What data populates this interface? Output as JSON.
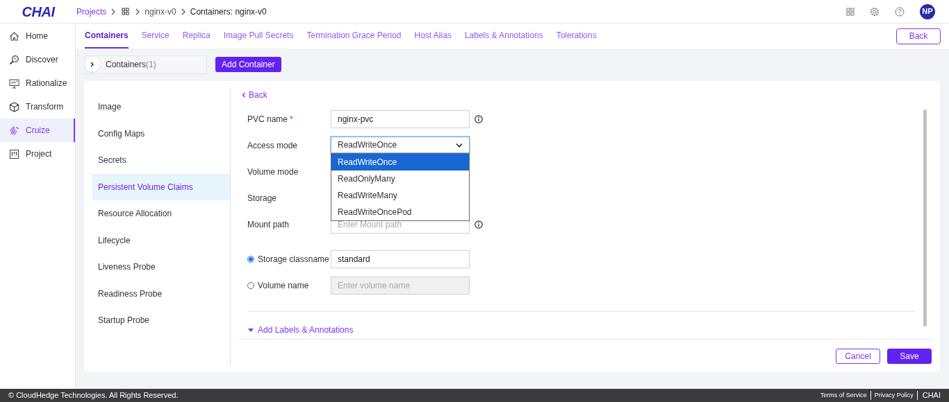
{
  "header": {
    "logo": "CHAI",
    "breadcrumb": [
      {
        "kind": "link",
        "text": "Projects"
      },
      {
        "kind": "icon"
      },
      {
        "kind": "text",
        "text": "nginx-v0"
      },
      {
        "kind": "current",
        "text": "Containers: nginx-v0"
      }
    ],
    "avatar": "NP"
  },
  "sidebar": {
    "items": [
      {
        "label": "Home",
        "selected": false
      },
      {
        "label": "Discover",
        "selected": false
      },
      {
        "label": "Rationalize",
        "selected": false
      },
      {
        "label": "Transform",
        "selected": false
      },
      {
        "label": "Cruize",
        "selected": true
      },
      {
        "label": "Project",
        "selected": false
      }
    ]
  },
  "tabs": [
    {
      "label": "Containers",
      "selected": true
    },
    {
      "label": "Service",
      "selected": false
    },
    {
      "label": "Replica",
      "selected": false
    },
    {
      "label": "Image Pull Secrets",
      "selected": false
    },
    {
      "label": "Termination Grace Period",
      "selected": false
    },
    {
      "label": "Host Alias",
      "selected": false
    },
    {
      "label": "Labels & Annotations",
      "selected": false
    },
    {
      "label": "Tolerations",
      "selected": false
    }
  ],
  "back_button": "Back",
  "containers_panel": {
    "label": "Containers",
    "count": "(1)",
    "expanded": false
  },
  "add_container_button": "Add Container",
  "section_menu": [
    {
      "label": "Image",
      "selected": false
    },
    {
      "label": "Config Maps",
      "selected": false
    },
    {
      "label": "Secrets",
      "selected": false
    },
    {
      "label": "Persistent Volume Claims",
      "selected": true
    },
    {
      "label": "Resource Allocation",
      "selected": false
    },
    {
      "label": "Lifecycle",
      "selected": false
    },
    {
      "label": "Liveness Probe",
      "selected": false
    },
    {
      "label": "Readiness Probe",
      "selected": false
    },
    {
      "label": "Startup Probe",
      "selected": false
    }
  ],
  "form": {
    "back_link": "Back",
    "fields": [
      {
        "kind": "text",
        "label": "PVC name",
        "required_mark": "*",
        "value": "nginx-pvc",
        "info": true
      },
      {
        "kind": "select",
        "label": "Access mode",
        "value": "ReadWriteOnce",
        "expanded": true,
        "options": [
          {
            "label": "ReadWriteOnce",
            "selected": true
          },
          {
            "label": "ReadOnlyMany",
            "selected": false
          },
          {
            "label": "ReadWriteMany",
            "selected": false
          },
          {
            "label": "ReadWriteOncePod",
            "selected": false
          }
        ]
      },
      {
        "kind": "covered",
        "label": "Volume mode"
      },
      {
        "kind": "covered",
        "label": "Storage"
      },
      {
        "kind": "text",
        "label": "Mount path",
        "placeholder": "Enter Mount path",
        "info": true
      },
      {
        "kind": "radio",
        "label": "Storage classname",
        "selected": true,
        "value": "standard",
        "disabled": false
      },
      {
        "kind": "radio",
        "label": "Volume name",
        "selected": false,
        "placeholder": "Enter volume name",
        "disabled": true
      }
    ],
    "collapsible": {
      "label": "Add Labels & Annotations",
      "expanded": false
    },
    "buttons": [
      {
        "kind": "secondary",
        "label": "Cancel"
      },
      {
        "kind": "primary",
        "label": "Save"
      }
    ]
  },
  "footer": {
    "copyright": "© CloudHedge Technologies. All Rights Reserved.",
    "links": [
      "Terms of Service",
      "Privacy Policy"
    ],
    "brand": "CHAI"
  }
}
